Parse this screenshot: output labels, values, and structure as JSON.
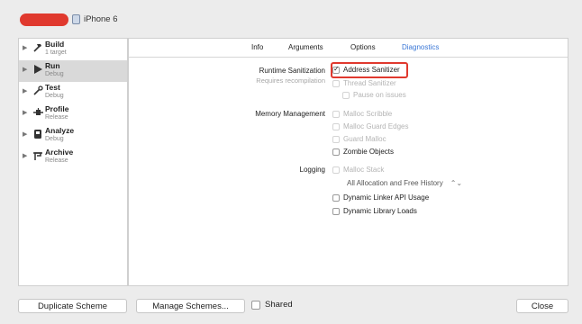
{
  "header": {
    "device_name": "iPhone 6"
  },
  "sidebar": {
    "actions": [
      {
        "name": "Build",
        "subtitle": "1 target",
        "icon": "hammer-icon"
      },
      {
        "name": "Run",
        "subtitle": "Debug",
        "icon": "play-icon"
      },
      {
        "name": "Test",
        "subtitle": "Debug",
        "icon": "wrench-icon"
      },
      {
        "name": "Profile",
        "subtitle": "Release",
        "icon": "gauge-icon"
      },
      {
        "name": "Analyze",
        "subtitle": "Debug",
        "icon": "analyze-icon"
      },
      {
        "name": "Archive",
        "subtitle": "Release",
        "icon": "archive-icon"
      }
    ],
    "selected": "Run"
  },
  "tabs": [
    "Info",
    "Arguments",
    "Options",
    "Diagnostics"
  ],
  "active_tab": "Diagnostics",
  "diagnostics": {
    "runtime_sanitization": {
      "label": "Runtime Sanitization",
      "sublabel": "Requires recompilation",
      "address_sanitizer": {
        "label": "Address Sanitizer",
        "checked": true
      },
      "thread_sanitizer": {
        "label": "Thread Sanitizer",
        "checked": false
      },
      "pause_on_issues": {
        "label": "Pause on issues",
        "checked": false
      }
    },
    "memory_management": {
      "label": "Memory Management",
      "malloc_scribble": "Malloc Scribble",
      "malloc_guard_edges": "Malloc Guard Edges",
      "guard_malloc": "Guard Malloc",
      "zombie_objects": "Zombie Objects"
    },
    "logging": {
      "label": "Logging",
      "malloc_stack": "Malloc Stack",
      "history_select": "All Allocation and Free History",
      "dynamic_linker_api_usage": "Dynamic Linker API Usage",
      "dynamic_library_loads": "Dynamic Library Loads"
    }
  },
  "footer": {
    "duplicate_scheme": "Duplicate Scheme",
    "manage_schemes": "Manage Schemes...",
    "shared": "Shared",
    "close": "Close"
  },
  "colors": {
    "accent": "#3a77d6",
    "highlight": "#e0392e",
    "selection": "#d9d9d9"
  }
}
